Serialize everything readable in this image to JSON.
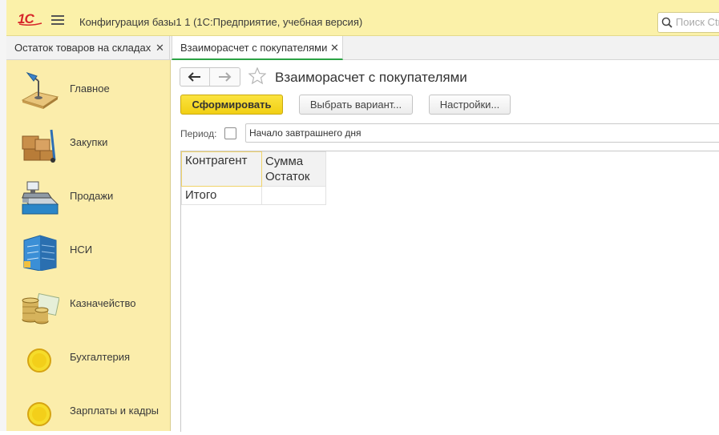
{
  "app": {
    "logo_icon": "1c-logo-icon",
    "title": "Конфигурация базы1 1  (1С:Предприятие, учебная версия)",
    "search_placeholder": "Поиск Ctrl+Shift+F"
  },
  "tabs": [
    {
      "label": "Остаток товаров на складах",
      "active": false
    },
    {
      "label": "Взаиморасчет с покупателями",
      "active": true
    }
  ],
  "sidebar": {
    "items": [
      {
        "label": "Главное",
        "icon": "desk-lamp-icon"
      },
      {
        "label": "Закупки",
        "icon": "boxes-cart-icon"
      },
      {
        "label": "Продажи",
        "icon": "cash-register-icon"
      },
      {
        "label": "НСИ",
        "icon": "building-icon"
      },
      {
        "label": "Казначейство",
        "icon": "coins-icon"
      },
      {
        "label": "Бухгалтерия",
        "icon": "circle-icon"
      },
      {
        "label": "Зарплаты и кадры",
        "icon": "circle-icon"
      }
    ]
  },
  "form": {
    "title": "Взаиморасчет с покупателями",
    "generate_button": "Сформировать",
    "variant_button": "Выбрать вариант...",
    "settings_button": "Настройки...",
    "period_label": "Период:",
    "period_checked": false,
    "period_value": "Начало завтрашнего дня"
  },
  "report": {
    "headers": [
      "Контрагент",
      "Сумма",
      "Остаток"
    ],
    "total_label": "Итого"
  },
  "colors": {
    "titlebar_bg": "#fbf1a9",
    "sidebar_bg": "#fbedab",
    "primary_button": "#f4d62a",
    "active_tab_underline": "#2ba344",
    "logo_red": "#d7262b"
  }
}
